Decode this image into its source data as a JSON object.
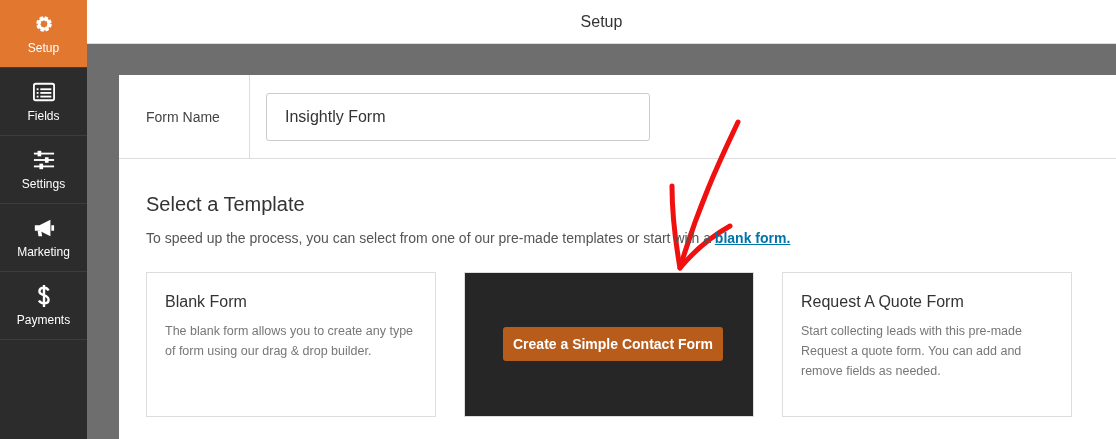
{
  "top_bar": {
    "title": "Setup"
  },
  "sidebar": {
    "items": [
      {
        "label": "Setup",
        "selected": true
      },
      {
        "label": "Fields",
        "selected": false
      },
      {
        "label": "Settings",
        "selected": false
      },
      {
        "label": "Marketing",
        "selected": false
      },
      {
        "label": "Payments",
        "selected": false
      }
    ]
  },
  "form_name": {
    "label": "Form Name",
    "value": "Insightly Form"
  },
  "templates": {
    "heading": "Select a Template",
    "intro": "To speed up the process, you can select from one of our pre-made templates or start with a",
    "link": "blank form.",
    "cards": [
      {
        "title": "Blank Form",
        "description": "The blank form allows you to create any type of form using our drag & drop builder.",
        "hovered": false
      },
      {
        "hovered": true,
        "button": "Create a Simple Contact Form"
      },
      {
        "title": "Request A Quote Form",
        "description": "Start collecting leads with this pre-made Request a quote form. You can add and remove fields as needed.",
        "hovered": false
      }
    ]
  }
}
